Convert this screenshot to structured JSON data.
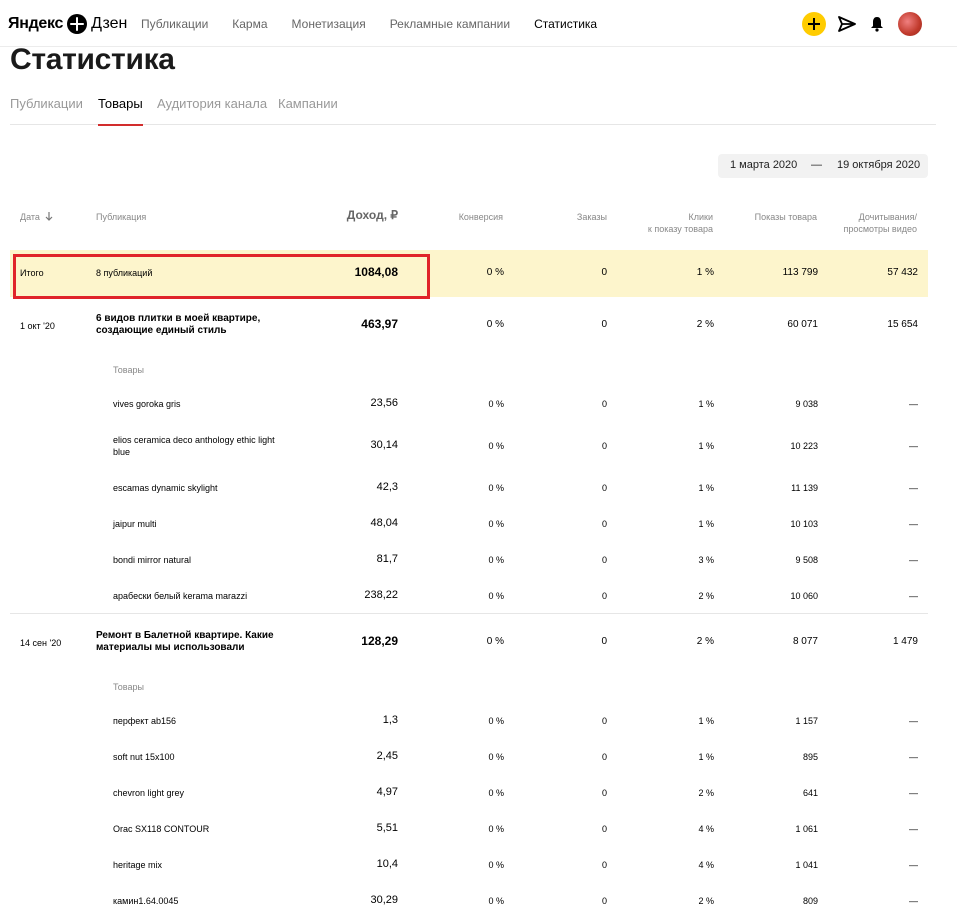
{
  "header": {
    "logo_yandex": "Яндекс",
    "logo_dzen": "Дзен",
    "nav": [
      "Публикации",
      "Карма",
      "Монетизация",
      "Рекламные кампании",
      "Статистика"
    ],
    "icons": [
      "plus-icon",
      "send-icon",
      "bell-icon",
      "avatar"
    ],
    "accent_color": "#ffcc00"
  },
  "page_title": "Статистика",
  "tabs": [
    "Публикации",
    "Товары",
    "Аудитория канала",
    "Кампании"
  ],
  "date_range": {
    "from": "1 марта 2020",
    "sep": "—",
    "to": "19 октября 2020"
  },
  "columns": {
    "date": "Дата",
    "publication": "Публикация",
    "income": "Доход, ₽",
    "conversion": "Конверсия",
    "orders": "Заказы",
    "clicks_line1": "Клики",
    "clicks_line2": "к показу товара",
    "views": "Показы товара",
    "reads_line1": "Дочитывания/",
    "reads_line2": "просмотры видео"
  },
  "total": {
    "label": "Итого",
    "publications": "8 публикаций",
    "income": "1084,08",
    "conversion": "0 %",
    "orders": "0",
    "clicks": "1 %",
    "views": "113 799",
    "reads": "57 432"
  },
  "pub1": {
    "date": "1 окт '20",
    "title_line1": "6 видов плитки в моей квартире,",
    "title_line2": "создающие единый стиль",
    "income": "463,97",
    "conversion": "0 %",
    "orders": "0",
    "clicks": "2 %",
    "views": "60 071",
    "reads": "15 654",
    "products_label": "Товары",
    "products": [
      {
        "name": "vives goroka gris",
        "name2": "",
        "income": "23,56",
        "conversion": "0 %",
        "orders": "0",
        "clicks": "1 %",
        "views": "9 038",
        "reads": "—"
      },
      {
        "name": "elios ceramica deco anthology ethic light",
        "name2": "blue",
        "income": "30,14",
        "conversion": "0 %",
        "orders": "0",
        "clicks": "1 %",
        "views": "10 223",
        "reads": "—"
      },
      {
        "name": "escamas dynamic skylight",
        "name2": "",
        "income": "42,3",
        "conversion": "0 %",
        "orders": "0",
        "clicks": "1 %",
        "views": "11 139",
        "reads": "—"
      },
      {
        "name": "jaipur multi",
        "name2": "",
        "income": "48,04",
        "conversion": "0 %",
        "orders": "0",
        "clicks": "1 %",
        "views": "10 103",
        "reads": "—"
      },
      {
        "name": "bondi mirror natural",
        "name2": "",
        "income": "81,7",
        "conversion": "0 %",
        "orders": "0",
        "clicks": "3 %",
        "views": "9 508",
        "reads": "—"
      },
      {
        "name": "арабески белый kerama marazzi",
        "name2": "",
        "income": "238,22",
        "conversion": "0 %",
        "orders": "0",
        "clicks": "2 %",
        "views": "10 060",
        "reads": "—"
      }
    ]
  },
  "pub2": {
    "date": "14 сен '20",
    "title_line1": "Ремонт в Балетной квартире. Какие",
    "title_line2": "материалы мы использовали",
    "income": "128,29",
    "conversion": "0 %",
    "orders": "0",
    "clicks": "2 %",
    "views": "8 077",
    "reads": "1 479",
    "products_label": "Товары",
    "products": [
      {
        "name": "перфект ab156",
        "income": "1,3",
        "conversion": "0 %",
        "orders": "0",
        "clicks": "1 %",
        "views": "1 157",
        "reads": "—"
      },
      {
        "name": "soft nut 15x100",
        "income": "2,45",
        "conversion": "0 %",
        "orders": "0",
        "clicks": "1 %",
        "views": "895",
        "reads": "—"
      },
      {
        "name": "chevron light grey",
        "income": "4,97",
        "conversion": "0 %",
        "orders": "0",
        "clicks": "2 %",
        "views": "641",
        "reads": "—"
      },
      {
        "name": "Orac SX118 CONTOUR",
        "income": "5,51",
        "conversion": "0 %",
        "orders": "0",
        "clicks": "4 %",
        "views": "1 061",
        "reads": "—"
      },
      {
        "name": "heritage mix",
        "income": "10,4",
        "conversion": "0 %",
        "orders": "0",
        "clicks": "4 %",
        "views": "1 041",
        "reads": "—"
      },
      {
        "name": "камин1.64.0045",
        "income": "30,29",
        "conversion": "0 %",
        "orders": "0",
        "clicks": "2 %",
        "views": "809",
        "reads": "—"
      }
    ]
  }
}
